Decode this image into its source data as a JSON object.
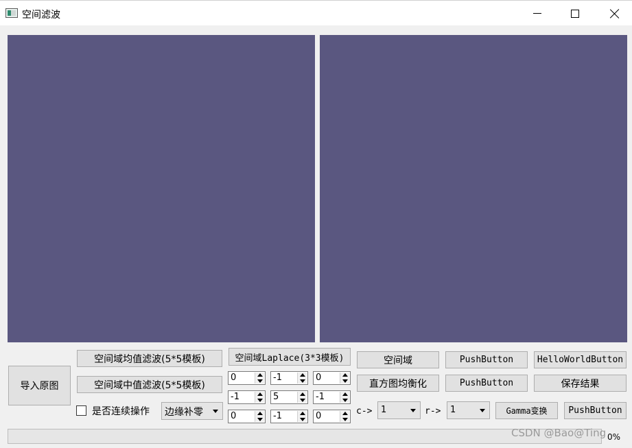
{
  "window": {
    "title": "空间滤波",
    "icon": "image-app-icon",
    "controls": [
      "minimize-icon",
      "maximize-icon",
      "close-icon"
    ]
  },
  "panels": {
    "background_color": "#5a5780"
  },
  "buttons": {
    "import_original": "导入原图",
    "mean_filter": "空间域均值滤波(5*5模板)",
    "median_filter": "空间域中值滤波(5*5模板)",
    "laplace": "空间域Laplace(3*3模板)",
    "spatial_domain": "空间域",
    "histogram_eq": "直方图均衡化",
    "push_button_1": "PushButton",
    "push_button_2": "PushButton",
    "hello_world": "HelloWorldButton",
    "save_result": "保存结果",
    "gamma": "Gamma变换",
    "push_button_3": "PushButton"
  },
  "continuous": {
    "label": "是否连续操作",
    "checked": false
  },
  "edge_mode": {
    "selected": "边缘补零"
  },
  "kernel": [
    [
      "0",
      "-1",
      "0"
    ],
    [
      "-1",
      "5",
      "-1"
    ],
    [
      "0",
      "-1",
      "0"
    ]
  ],
  "gamma_params": {
    "c_label": "c->",
    "c_value": "1",
    "r_label": "r->",
    "r_value": "1"
  },
  "progress": {
    "value": 0,
    "text": "0%"
  },
  "watermark": "CSDN @Bao@Ting"
}
